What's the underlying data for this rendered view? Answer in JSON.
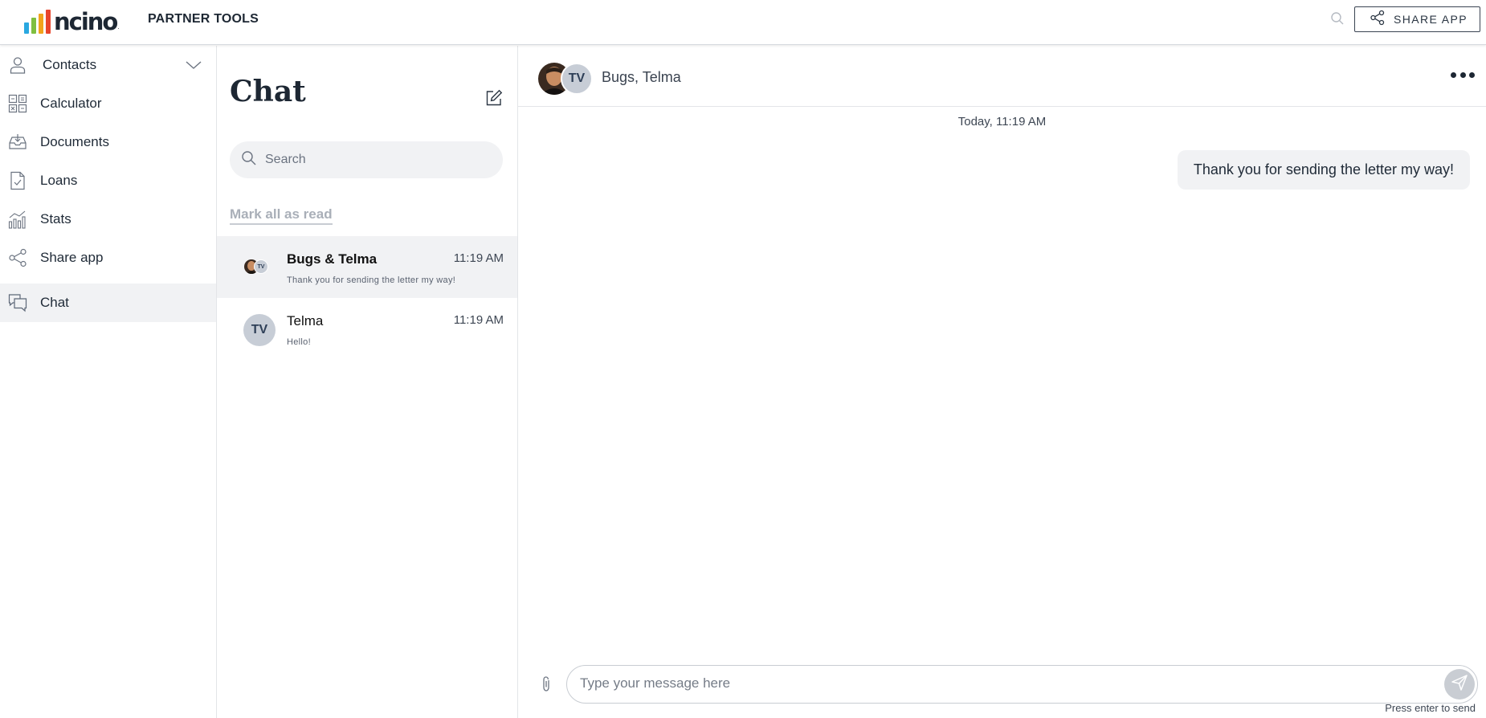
{
  "header": {
    "logo_text": "ncino",
    "logo_tm": ".",
    "logo_bar_colors": [
      "#2aa8e0",
      "#7fbf3f",
      "#f2a31b",
      "#e8452c"
    ],
    "app_title": "PARTNER TOOLS",
    "search_icon": "search-icon",
    "share_button_label": "SHARE APP",
    "share_icon": "share-icon"
  },
  "sidebar": {
    "items": [
      {
        "label": "Contacts",
        "icon": "person-icon",
        "has_chevron": true
      },
      {
        "label": "Calculator",
        "icon": "calculator-icon"
      },
      {
        "label": "Documents",
        "icon": "inbox-icon"
      },
      {
        "label": "Loans",
        "icon": "document-check-icon"
      },
      {
        "label": "Stats",
        "icon": "bar-chart-icon"
      },
      {
        "label": "Share app",
        "icon": "share-icon"
      },
      {
        "label": "Chat",
        "icon": "chat-bubbles-icon",
        "active": true
      }
    ]
  },
  "chatlist": {
    "title": "Chat",
    "search_placeholder": "Search",
    "mark_all_read": "Mark all as read",
    "conversations": [
      {
        "name": "Bugs & Telma",
        "time": "11:19 AM",
        "preview": "Thank you for sending the letter my way!",
        "avatar_initials": "TV",
        "selected": true
      },
      {
        "name": "Telma",
        "time": "11:19 AM",
        "preview": "Hello!",
        "avatar_initials": "TV"
      }
    ]
  },
  "conversation": {
    "title": "Bugs, Telma",
    "avatar_initials": "TV",
    "date_separator": "Today, 11:19 AM",
    "messages": [
      {
        "text": "Thank you for sending the letter my way!",
        "outgoing": true
      }
    ],
    "input_placeholder": "Type your message here",
    "send_hint": "Press enter to send"
  },
  "colors": {
    "avatar_bg": "#c7cdd6",
    "avatar_text": "#2e3f57",
    "active_row": "#f1f2f4"
  }
}
